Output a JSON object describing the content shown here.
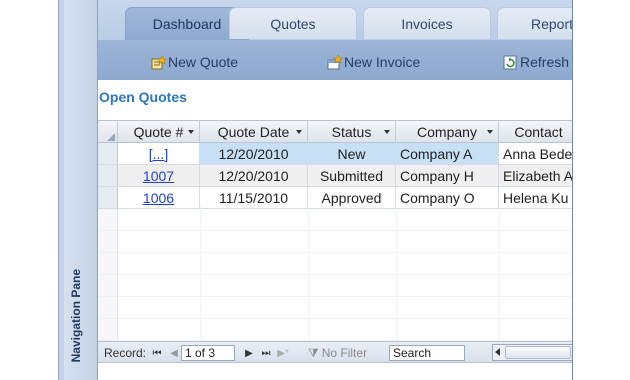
{
  "nav_pane": {
    "label": "Navigation Pane"
  },
  "tabs": [
    {
      "label": "Dashboard",
      "active": true
    },
    {
      "label": "Quotes",
      "active": false
    },
    {
      "label": "Invoices",
      "active": false
    },
    {
      "label": "Report",
      "active": false
    }
  ],
  "commands": [
    {
      "label": "New Quote",
      "icon": "new-quote-icon"
    },
    {
      "label": "New Invoice",
      "icon": "new-invoice-icon"
    },
    {
      "label": "Refresh",
      "icon": "refresh-icon"
    }
  ],
  "section_title": "Open Quotes",
  "table": {
    "columns": [
      "Quote #",
      "Quote Date",
      "Status",
      "Company",
      "Contact"
    ],
    "rows": [
      {
        "quote": "[...]",
        "date": "12/20/2010",
        "status": "New",
        "company": "Company A",
        "contact": "Anna Bede"
      },
      {
        "quote": "1007",
        "date": "12/20/2010",
        "status": "Submitted",
        "company": "Company H",
        "contact": "Elizabeth A"
      },
      {
        "quote": "1006",
        "date": "11/15/2010",
        "status": "Approved",
        "company": "Company O",
        "contact": "Helena Ku"
      }
    ]
  },
  "record_nav": {
    "label": "Record:",
    "position": "1 of 3",
    "filter_label": "No Filter",
    "search_placeholder": "Search"
  },
  "colors": {
    "accent": "#2c77c4",
    "link": "#1d3fd0",
    "selected_cell": "#c7e0f6",
    "header_band": "#b7cae4"
  }
}
